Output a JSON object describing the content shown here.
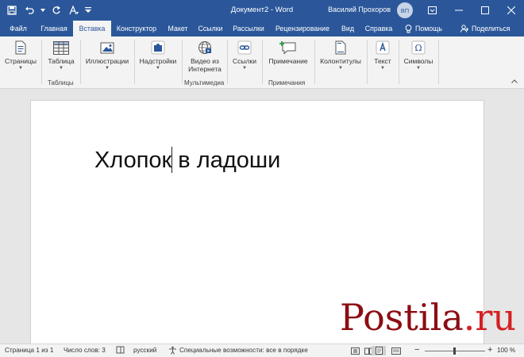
{
  "titlebar": {
    "doc_title": "Документ2 - Word",
    "user_name": "Василий Прохоров",
    "avatar_initials": "ВП"
  },
  "tabs": [
    {
      "label": "Файл"
    },
    {
      "label": "Главная"
    },
    {
      "label": "Вставка",
      "active": true
    },
    {
      "label": "Конструктор"
    },
    {
      "label": "Макет"
    },
    {
      "label": "Ссылки"
    },
    {
      "label": "Рассылки"
    },
    {
      "label": "Рецензирование"
    },
    {
      "label": "Вид"
    },
    {
      "label": "Справка"
    }
  ],
  "tabs_right": {
    "help_label": "Помощь",
    "share_label": "Поделиться"
  },
  "ribbon": {
    "pages_label": "Страницы",
    "table_label": "Таблица",
    "table_group": "Таблицы",
    "illustrations_label": "Иллюстрации",
    "addins_label": "Надстройки",
    "video_label_1": "Видео из",
    "video_label_2": "Интернета",
    "media_group": "Мультимедиа",
    "links_label": "Ссылки",
    "comment_label": "Примечание",
    "comments_group": "Примечания",
    "headers_label": "Колонтитулы",
    "text_label": "Текст",
    "symbols_label": "Символы"
  },
  "document": {
    "text_before_caret": "Хлопок",
    "text_after_caret": " в ладоши"
  },
  "watermark": {
    "part1": "Postila",
    "part2": ".ru"
  },
  "statusbar": {
    "page": "Страница 1 из 1",
    "words": "Число слов: 3",
    "language": "русский",
    "accessibility": "Специальные возможности: все в порядке",
    "zoom": "100 %",
    "zoom_minus": "−",
    "zoom_plus": "+"
  },
  "colors": {
    "titlebar": "#2b579a",
    "ribbon": "#f3f3f3",
    "watermark_dark": "#8c0d13",
    "watermark_red": "#d41f24"
  }
}
